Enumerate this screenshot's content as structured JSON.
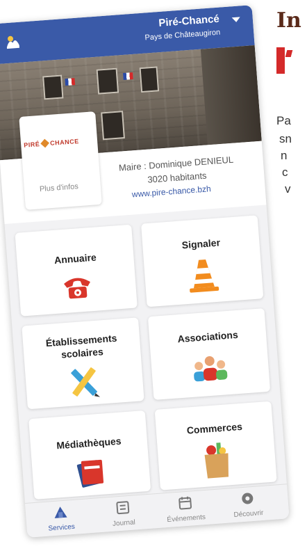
{
  "article": {
    "title_fragment": "In",
    "lines": [
      "Pa",
      "sn",
      "n",
      "c",
      "v"
    ]
  },
  "header": {
    "commune": "Piré-Chancé",
    "subtitle": "Pays de Châteaugiron"
  },
  "info": {
    "logo_left": "PIRÉ",
    "logo_right": "CHANCE",
    "more": "Plus d'infos",
    "mayor": "Maire : Dominique DENIEUL",
    "population": "3020 habitants",
    "website": "www.pire-chance.bzh"
  },
  "tiles": [
    {
      "label": "Annuaire",
      "icon": "telephone-icon"
    },
    {
      "label": "Signaler",
      "icon": "traffic-cone-icon"
    },
    {
      "label": "Établissements scolaires",
      "line1": "Établissements",
      "line2": "scolaires",
      "icon": "ruler-pencil-icon"
    },
    {
      "label": "Associations",
      "icon": "people-icon"
    },
    {
      "label": "Médiathèques",
      "icon": "books-icon"
    },
    {
      "label": "Commerces",
      "icon": "grocery-bag-icon"
    }
  ],
  "nav": [
    {
      "label": "Services",
      "icon": "services-icon",
      "active": true
    },
    {
      "label": "Journal",
      "icon": "newspaper-icon"
    },
    {
      "label": "Événements",
      "icon": "calendar-icon"
    },
    {
      "label": "Découvrir",
      "icon": "compass-icon"
    }
  ],
  "colors": {
    "primary": "#3a5aa8",
    "accent_red": "#d42a2a",
    "title_brown": "#5a2a1a"
  }
}
